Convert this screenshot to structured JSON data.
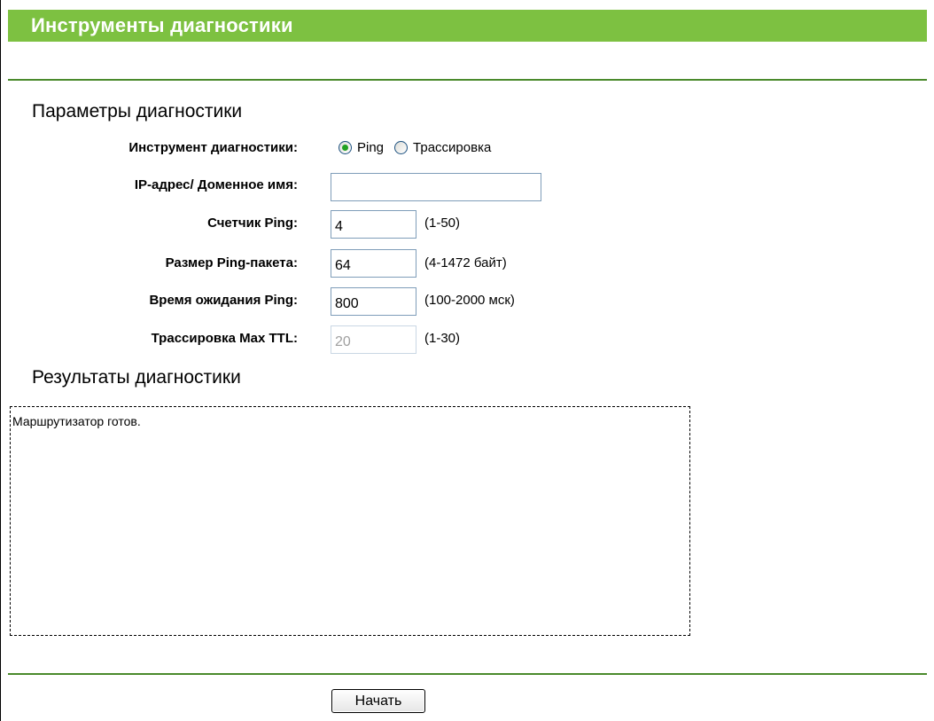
{
  "header": {
    "title": "Инструменты диагностики"
  },
  "params": {
    "heading": "Параметры диагностики",
    "tool_label": "Инструмент диагностики:",
    "tool_options": [
      {
        "label": "Ping",
        "selected": true
      },
      {
        "label": "Трассировка",
        "selected": false
      }
    ],
    "ip_label": "IP-адрес/ Доменное имя:",
    "ip_value": "",
    "ping_count_label": "Счетчик Ping:",
    "ping_count_value": "4",
    "ping_count_hint": "(1-50)",
    "ping_size_label": "Размер Ping-пакета:",
    "ping_size_value": "64",
    "ping_size_hint": "(4-1472 байт)",
    "ping_timeout_label": "Время ожидания Ping:",
    "ping_timeout_value": "800",
    "ping_timeout_hint": "(100-2000 мск)",
    "max_ttl_label": "Трассировка Max TTL:",
    "max_ttl_value": "20",
    "max_ttl_hint": "(1-30)"
  },
  "results": {
    "heading": "Результаты диагностики",
    "text": "Маршрутизатор готов."
  },
  "actions": {
    "start_label": "Начать"
  },
  "colors": {
    "title_bar": "#7dc141",
    "divider": "#4a8a2c",
    "radio_dot": "#21a121"
  }
}
